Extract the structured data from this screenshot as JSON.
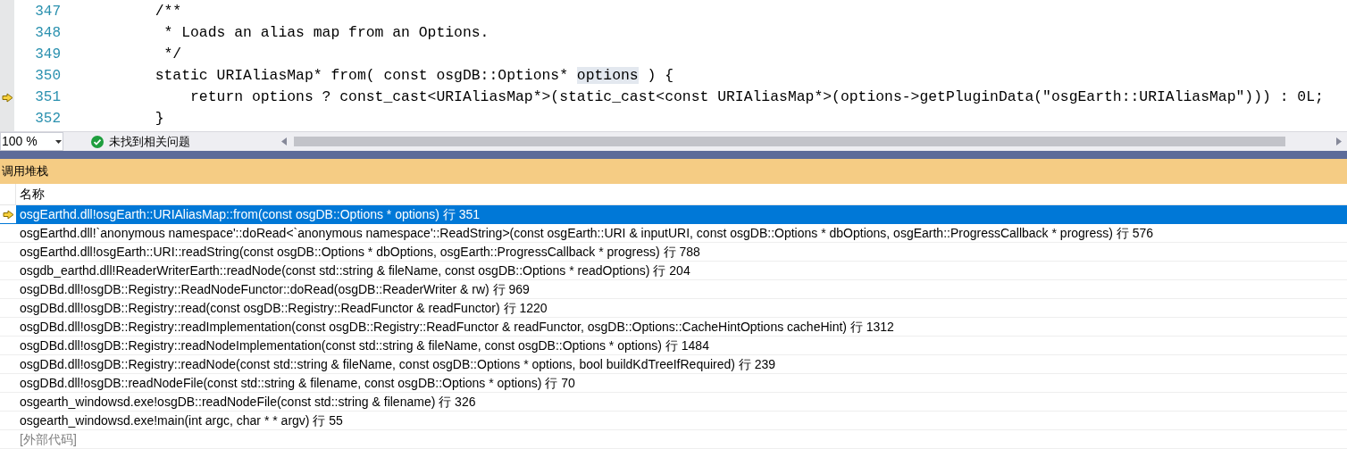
{
  "editor": {
    "lines": [
      {
        "number": "347",
        "current": false,
        "segments": [
          {
            "text": "        /**",
            "highlighted": false
          }
        ]
      },
      {
        "number": "348",
        "current": false,
        "segments": [
          {
            "text": "         * Loads an alias map from an Options.",
            "highlighted": false
          }
        ]
      },
      {
        "number": "349",
        "current": false,
        "segments": [
          {
            "text": "         */",
            "highlighted": false
          }
        ]
      },
      {
        "number": "350",
        "current": false,
        "segments": [
          {
            "text": "        static URIAliasMap* from( const osgDB::Options* ",
            "highlighted": false
          },
          {
            "text": "options",
            "highlighted": true
          },
          {
            "text": " ) {",
            "highlighted": false
          }
        ]
      },
      {
        "number": "351",
        "current": true,
        "segments": [
          {
            "text": "            return options ? const_cast<URIAliasMap*>(static_cast<const URIAliasMap*>(options->getPluginData(\"osgEarth::URIAliasMap\"))) : 0L;",
            "highlighted": false
          }
        ]
      },
      {
        "number": "352",
        "current": false,
        "segments": [
          {
            "text": "        }",
            "highlighted": false
          }
        ]
      }
    ]
  },
  "status_bar": {
    "zoom": "100 %",
    "issues": "未找到相关问题"
  },
  "call_stack": {
    "title": "调用堆栈",
    "columns": [
      "名称"
    ],
    "rows": [
      {
        "kind": "frame",
        "name": "osgEarthd.dll!osgEarth::URIAliasMap::from(const osgDB::Options * options) 行 351",
        "selected": true,
        "current": true
      },
      {
        "kind": "frame",
        "name": "osgEarthd.dll!`anonymous namespace'::doRead<`anonymous namespace'::ReadString>(const osgEarth::URI & inputURI, const osgDB::Options * dbOptions, osgEarth::ProgressCallback * progress) 行 576",
        "selected": false,
        "current": false
      },
      {
        "kind": "frame",
        "name": "osgEarthd.dll!osgEarth::URI::readString(const osgDB::Options * dbOptions, osgEarth::ProgressCallback * progress) 行 788",
        "selected": false,
        "current": false
      },
      {
        "kind": "frame",
        "name": "osgdb_earthd.dll!ReaderWriterEarth::readNode(const std::string & fileName, const osgDB::Options * readOptions) 行 204",
        "selected": false,
        "current": false
      },
      {
        "kind": "frame",
        "name": "osgDBd.dll!osgDB::Registry::ReadNodeFunctor::doRead(osgDB::ReaderWriter & rw) 行 969",
        "selected": false,
        "current": false
      },
      {
        "kind": "frame",
        "name": "osgDBd.dll!osgDB::Registry::read(const osgDB::Registry::ReadFunctor & readFunctor) 行 1220",
        "selected": false,
        "current": false
      },
      {
        "kind": "frame",
        "name": "osgDBd.dll!osgDB::Registry::readImplementation(const osgDB::Registry::ReadFunctor & readFunctor, osgDB::Options::CacheHintOptions cacheHint) 行 1312",
        "selected": false,
        "current": false
      },
      {
        "kind": "frame",
        "name": "osgDBd.dll!osgDB::Registry::readNodeImplementation(const std::string & fileName, const osgDB::Options * options) 行 1484",
        "selected": false,
        "current": false
      },
      {
        "kind": "frame",
        "name": "osgDBd.dll!osgDB::Registry::readNode(const std::string & fileName, const osgDB::Options * options, bool buildKdTreeIfRequired) 行 239",
        "selected": false,
        "current": false
      },
      {
        "kind": "frame",
        "name": "osgDBd.dll!osgDB::readNodeFile(const std::string & filename, const osgDB::Options * options) 行 70",
        "selected": false,
        "current": false
      },
      {
        "kind": "frame",
        "name": "osgearth_windowsd.exe!osgDB::readNodeFile(const std::string & filename) 行 326",
        "selected": false,
        "current": false
      },
      {
        "kind": "frame",
        "name": "osgearth_windowsd.exe!main(int argc, char * * argv) 行 55",
        "selected": false,
        "current": false
      },
      {
        "kind": "external",
        "name": "[外部代码]",
        "selected": false,
        "current": false
      }
    ]
  }
}
